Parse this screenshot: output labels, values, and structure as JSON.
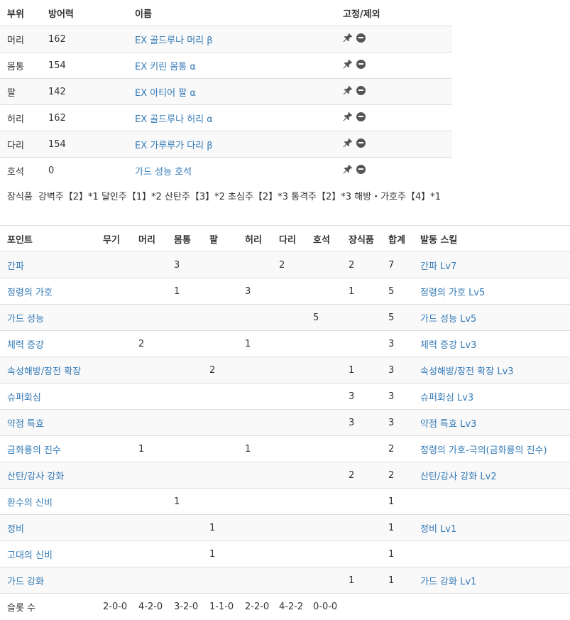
{
  "armor": {
    "headers": [
      "부위",
      "방어력",
      "이름",
      "고정/제외"
    ],
    "rows": [
      {
        "part": "머리",
        "defense": "162",
        "name": "EX 골드루나 머리 β"
      },
      {
        "part": "몸통",
        "defense": "154",
        "name": "EX 키린 몸통 α"
      },
      {
        "part": "팔",
        "defense": "142",
        "name": "EX 아티어 팔 α"
      },
      {
        "part": "허리",
        "defense": "162",
        "name": "EX 골드루나 허리 α"
      },
      {
        "part": "다리",
        "defense": "154",
        "name": "EX 가루루가 다리 β"
      },
      {
        "part": "호석",
        "defense": "0",
        "name": "가드 성능 호석"
      }
    ],
    "icons": [
      "pin-icon",
      "minus-circle-icon"
    ]
  },
  "decorations": {
    "label": "장식품",
    "text": "강벽주【2】*1 달인주【1】*2 산탄주【3】*2 초심주【2】*3 통격주【2】*3 해방・가호주【4】*1"
  },
  "skills": {
    "headers": [
      "포인트",
      "무기",
      "머리",
      "몸통",
      "팔",
      "허리",
      "다리",
      "호석",
      "장식품",
      "합계",
      "발동 스킬"
    ],
    "rows": [
      {
        "name": "간파",
        "weapon": "",
        "head": "",
        "body": "3",
        "arm": "",
        "waist": "",
        "leg": "2",
        "charm": "",
        "deco": "2",
        "total": "7",
        "active": "간파 Lv7"
      },
      {
        "name": "정령의 가호",
        "weapon": "",
        "head": "",
        "body": "1",
        "arm": "",
        "waist": "3",
        "leg": "",
        "charm": "",
        "deco": "1",
        "total": "5",
        "active": "정령의 가호 Lv5"
      },
      {
        "name": "가드 성능",
        "weapon": "",
        "head": "",
        "body": "",
        "arm": "",
        "waist": "",
        "leg": "",
        "charm": "5",
        "deco": "",
        "total": "5",
        "active": "가드 성능 Lv5"
      },
      {
        "name": "체력 증강",
        "weapon": "",
        "head": "2",
        "body": "",
        "arm": "",
        "waist": "1",
        "leg": "",
        "charm": "",
        "deco": "",
        "total": "3",
        "active": "체력 증강 Lv3"
      },
      {
        "name": "속성해방/장전 확장",
        "weapon": "",
        "head": "",
        "body": "",
        "arm": "2",
        "waist": "",
        "leg": "",
        "charm": "",
        "deco": "1",
        "total": "3",
        "active": "속성해방/장전 확장 Lv3"
      },
      {
        "name": "슈퍼회심",
        "weapon": "",
        "head": "",
        "body": "",
        "arm": "",
        "waist": "",
        "leg": "",
        "charm": "",
        "deco": "3",
        "total": "3",
        "active": "슈퍼회심 Lv3"
      },
      {
        "name": "약점 특효",
        "weapon": "",
        "head": "",
        "body": "",
        "arm": "",
        "waist": "",
        "leg": "",
        "charm": "",
        "deco": "3",
        "total": "3",
        "active": "약점 특효 Lv3"
      },
      {
        "name": "금화룡의 진수",
        "weapon": "",
        "head": "1",
        "body": "",
        "arm": "",
        "waist": "1",
        "leg": "",
        "charm": "",
        "deco": "",
        "total": "2",
        "active": "정령의 가호-극의(금화룡의 진수)"
      },
      {
        "name": "산탄/강사 강화",
        "weapon": "",
        "head": "",
        "body": "",
        "arm": "",
        "waist": "",
        "leg": "",
        "charm": "",
        "deco": "2",
        "total": "2",
        "active": "산탄/강사 강화 Lv2"
      },
      {
        "name": "환수의 신비",
        "weapon": "",
        "head": "",
        "body": "1",
        "arm": "",
        "waist": "",
        "leg": "",
        "charm": "",
        "deco": "",
        "total": "1",
        "active": ""
      },
      {
        "name": "정비",
        "weapon": "",
        "head": "",
        "body": "",
        "arm": "1",
        "waist": "",
        "leg": "",
        "charm": "",
        "deco": "",
        "total": "1",
        "active": "정비 Lv1"
      },
      {
        "name": "고대의 신비",
        "weapon": "",
        "head": "",
        "body": "",
        "arm": "1",
        "waist": "",
        "leg": "",
        "charm": "",
        "deco": "",
        "total": "1",
        "active": ""
      },
      {
        "name": "가드 강화",
        "weapon": "",
        "head": "",
        "body": "",
        "arm": "",
        "waist": "",
        "leg": "",
        "charm": "",
        "deco": "1",
        "total": "1",
        "active": "가드 강화 Lv1"
      }
    ],
    "slots": {
      "label": "슬롯 수",
      "weapon": "2-0-0",
      "head": "4-2-0",
      "body": "3-2-0",
      "arm": "1-1-0",
      "waist": "2-2-0",
      "leg": "4-2-2",
      "charm": "0-0-0"
    }
  },
  "colors": {
    "link": "#337ab7",
    "text": "#333333",
    "stripe": "#f9f9f9",
    "border": "#dddddd"
  }
}
